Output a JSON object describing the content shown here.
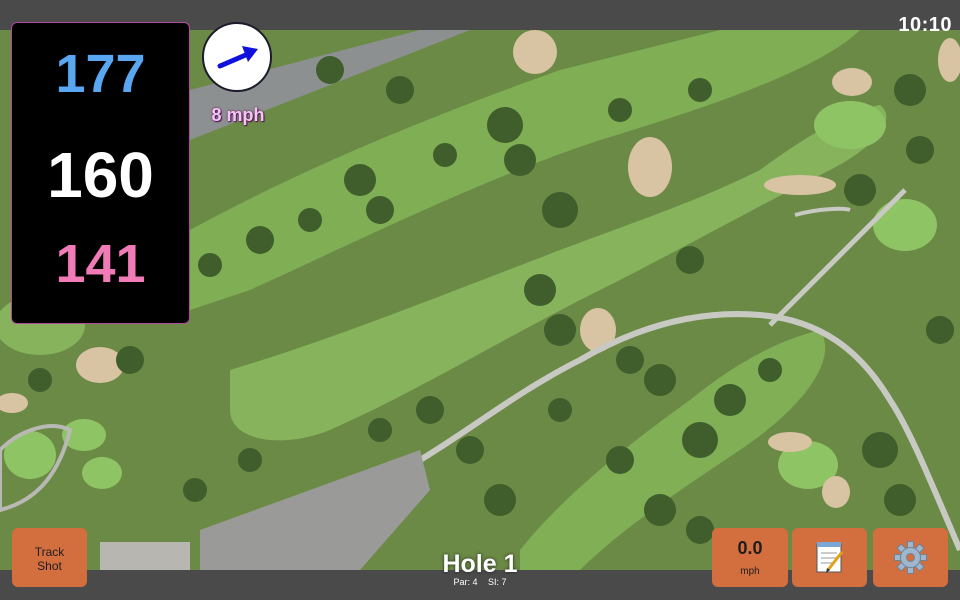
{
  "clock": "10:10",
  "distances": {
    "back": "177",
    "middle": "160",
    "front": "141"
  },
  "wind": {
    "speed": "8 mph",
    "icon": "wind-direction-arrow-icon"
  },
  "buttons": {
    "track_shot_line1": "Track",
    "track_shot_line2": "Shot",
    "speed_value": "0.0",
    "speed_unit": "mph",
    "notes_icon": "notepad-icon",
    "settings_icon": "gear-icon"
  },
  "hole": {
    "title": "Hole 1",
    "par": "Par: 4",
    "si": "SI: 7"
  },
  "colors": {
    "back_distance": "#5aa7f1",
    "middle_distance": "#ffffff",
    "front_distance": "#f17bb6",
    "button_bg": "#d36f3f",
    "wind_text": "#f0c8f0"
  }
}
